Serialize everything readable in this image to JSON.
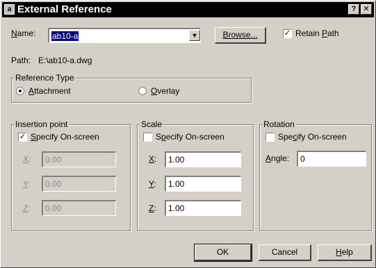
{
  "window": {
    "title": "External Reference",
    "help_glyph": "?",
    "close_glyph": "✕",
    "icon_name": "autocad-app-icon"
  },
  "name_row": {
    "label": "Name:",
    "value": "ab10-a",
    "dropdown_icon": "chevron-down-icon",
    "browse_label": "Browse...",
    "retain_path_label": "Retain Path",
    "retain_path_checked": true
  },
  "path_row": {
    "label": "Path:",
    "value": "E:\\ab10-a.dwg"
  },
  "reference_type": {
    "title": "Reference Type",
    "options": [
      {
        "label": "Attachment",
        "selected": true
      },
      {
        "label": "Overlay",
        "selected": false
      }
    ]
  },
  "insertion_point": {
    "title": "Insertion point",
    "specify_label": "Specify On-screen",
    "specify_checked": true,
    "fields": [
      {
        "label": "X:",
        "value": "0.00"
      },
      {
        "label": "Y:",
        "value": "0.00"
      },
      {
        "label": "Z:",
        "value": "0.00"
      }
    ]
  },
  "scale": {
    "title": "Scale",
    "specify_label": "Specify On-screen",
    "specify_checked": false,
    "fields": [
      {
        "label": "X:",
        "value": "1.00"
      },
      {
        "label": "Y:",
        "value": "1.00"
      },
      {
        "label": "Z:",
        "value": "1.00"
      }
    ]
  },
  "rotation": {
    "title": "Rotation",
    "specify_label": "Specify On-screen",
    "specify_checked": false,
    "angle_label": "Angle:",
    "angle_value": "0"
  },
  "buttons": {
    "ok": "OK",
    "cancel": "Cancel",
    "help": "Help"
  },
  "colors": {
    "dialog_face": "#d4d0c8",
    "title_bar": "#000000",
    "disabled_text": "#8a8a8a"
  }
}
